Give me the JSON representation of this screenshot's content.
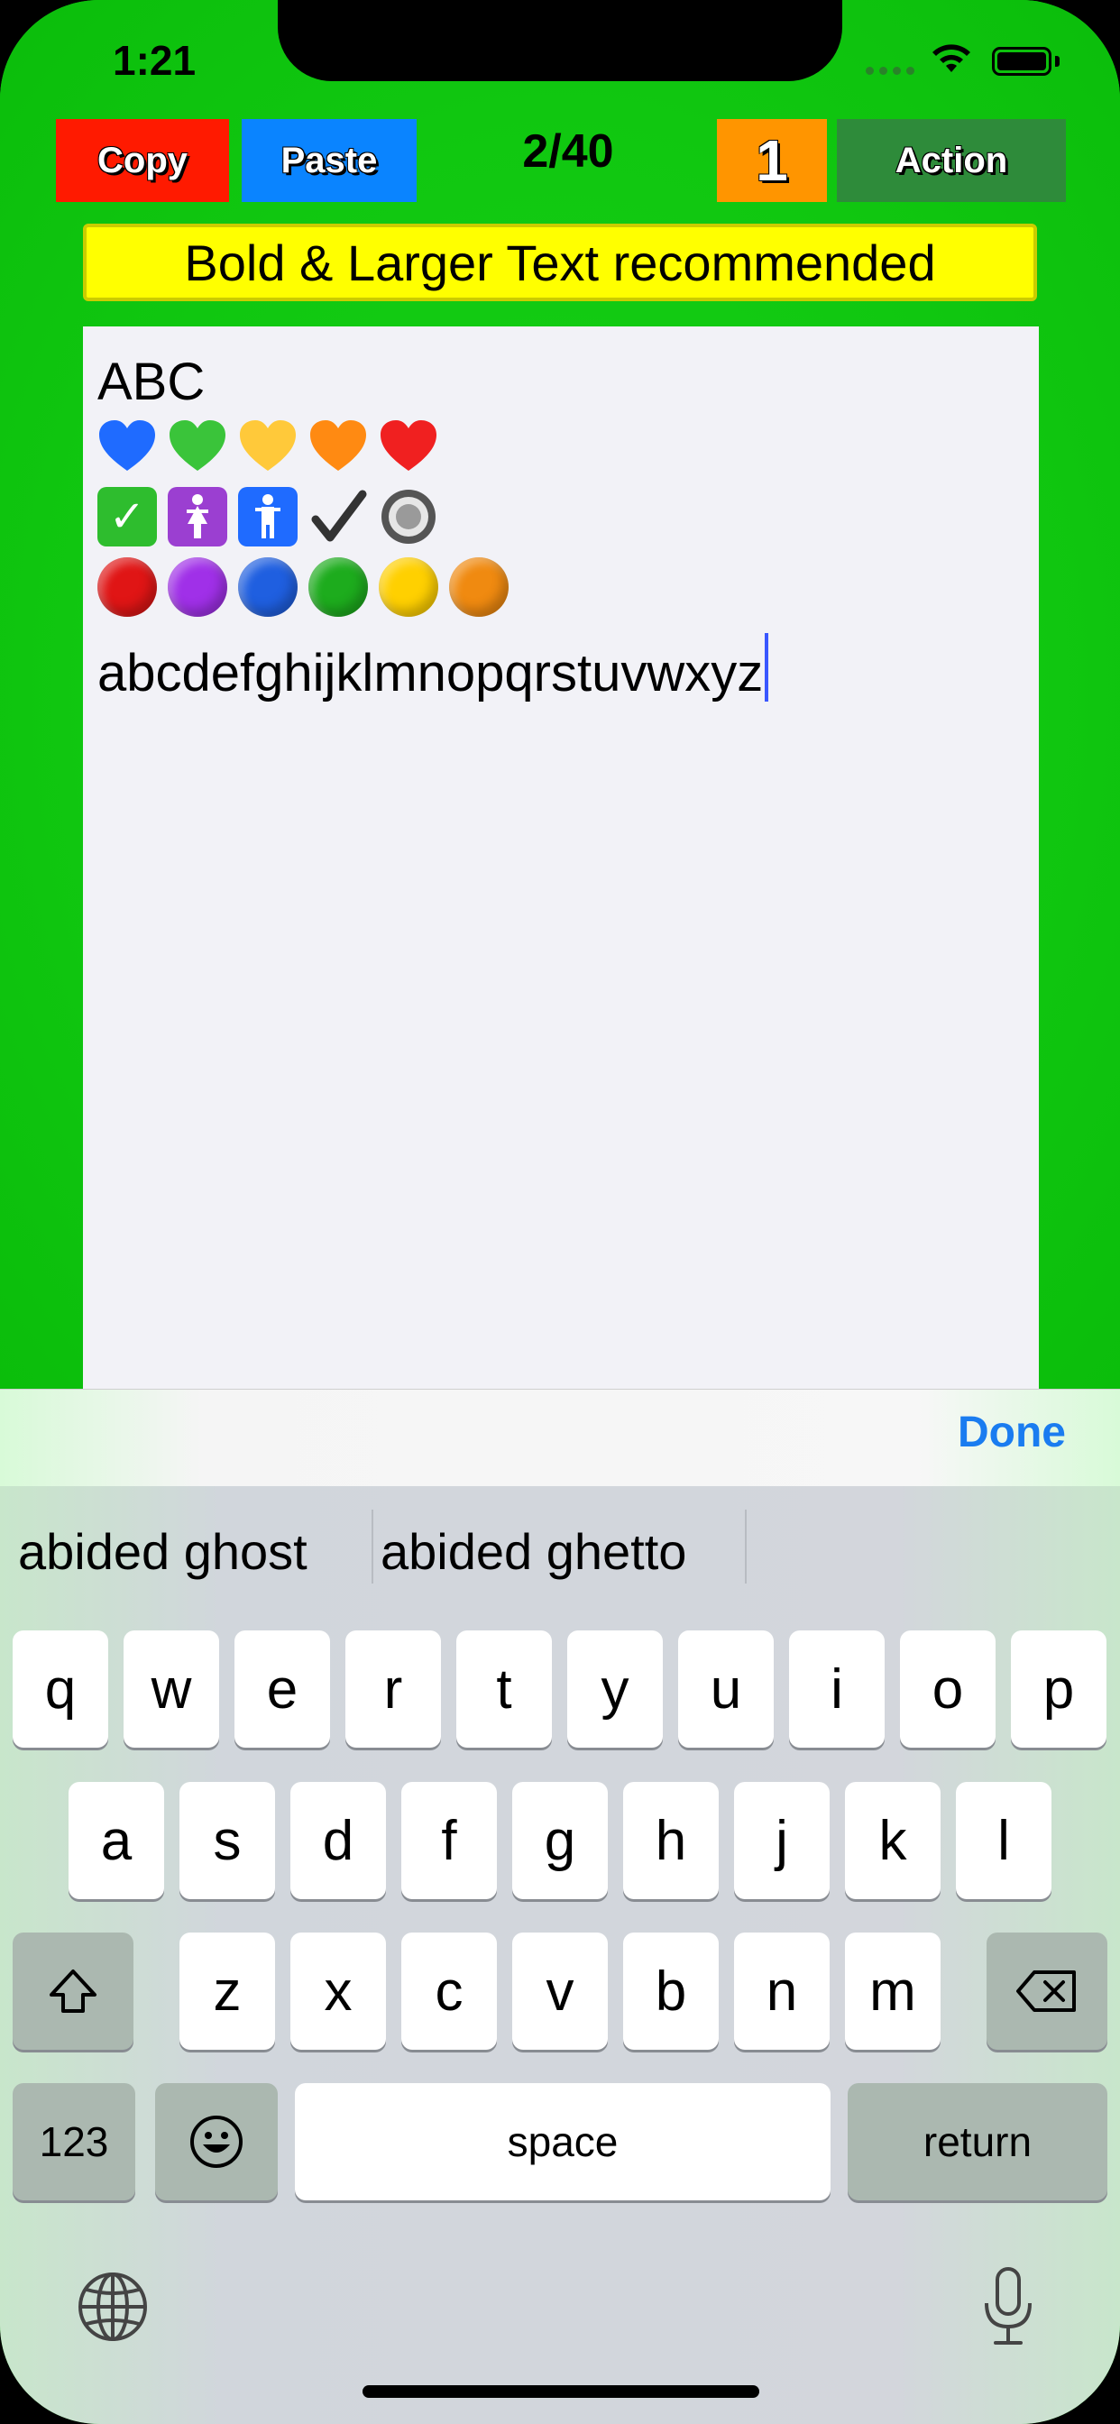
{
  "status": {
    "time": "1:21"
  },
  "toolbar": {
    "copy_label": "Copy",
    "paste_label": "Paste",
    "page_counter": "2/40",
    "number_label": "1",
    "action_label": "Action",
    "colors": {
      "copy": "#ff1a00",
      "paste": "#0a84ff",
      "number": "#ff9500",
      "action": "#2e8b3a"
    }
  },
  "banner": {
    "text": "Bold & Larger Text recommended"
  },
  "editor": {
    "line1": "ABC",
    "emoji_row1": [
      "blue-heart",
      "green-heart",
      "yellow-heart",
      "orange-heart",
      "red-heart"
    ],
    "emoji_row2": [
      "check-mark-button",
      "womens-room",
      "mens-room",
      "check-mark",
      "radio-button"
    ],
    "emoji_row3": [
      "red-circle",
      "purple-circle",
      "blue-circle",
      "green-circle",
      "yellow-circle",
      "orange-circle"
    ],
    "alphabet": "abcdefghijklmnopqrstuvwxyz"
  },
  "accessory": {
    "done_label": "Done"
  },
  "keyboard": {
    "suggestions": [
      "abided ghost",
      "abided ghetto"
    ],
    "row1": [
      "q",
      "w",
      "e",
      "r",
      "t",
      "y",
      "u",
      "i",
      "o",
      "p"
    ],
    "row2": [
      "a",
      "s",
      "d",
      "f",
      "g",
      "h",
      "j",
      "k",
      "l"
    ],
    "row3": [
      "z",
      "x",
      "c",
      "v",
      "b",
      "n",
      "m"
    ],
    "numbers_label": "123",
    "space_label": "space",
    "return_label": "return"
  }
}
